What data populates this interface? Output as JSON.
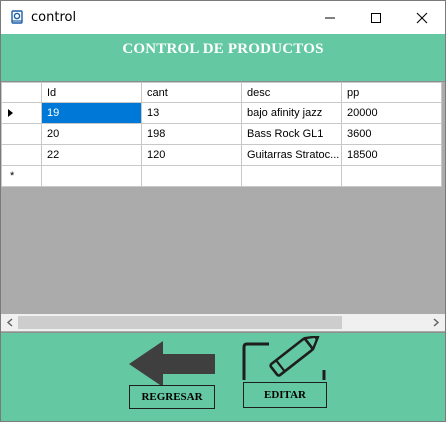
{
  "window": {
    "title": "control",
    "controls": [
      "minimize",
      "maximize",
      "close"
    ]
  },
  "header": {
    "title": "CONTROL DE PRODUCTOS"
  },
  "grid": {
    "columns": [
      "Id",
      "cant",
      "desc",
      "pp"
    ],
    "rows": [
      [
        "19",
        "13",
        "bajo afinity jazz",
        "20000"
      ],
      [
        "20",
        "198",
        "Bass Rock GL1",
        "3600"
      ],
      [
        "22",
        "120",
        "Guitarras Stratoc...",
        "18500"
      ]
    ],
    "current_row_marker": "▸",
    "new_row_marker": "*",
    "selected_color": "#0078d7",
    "background_color": "#ababab"
  },
  "buttons": {
    "back_label": "REGRESAR",
    "edit_label": "EDITAR"
  },
  "colors": {
    "form_background": "#64c9a3",
    "icon_color": "#3f3f3f"
  }
}
